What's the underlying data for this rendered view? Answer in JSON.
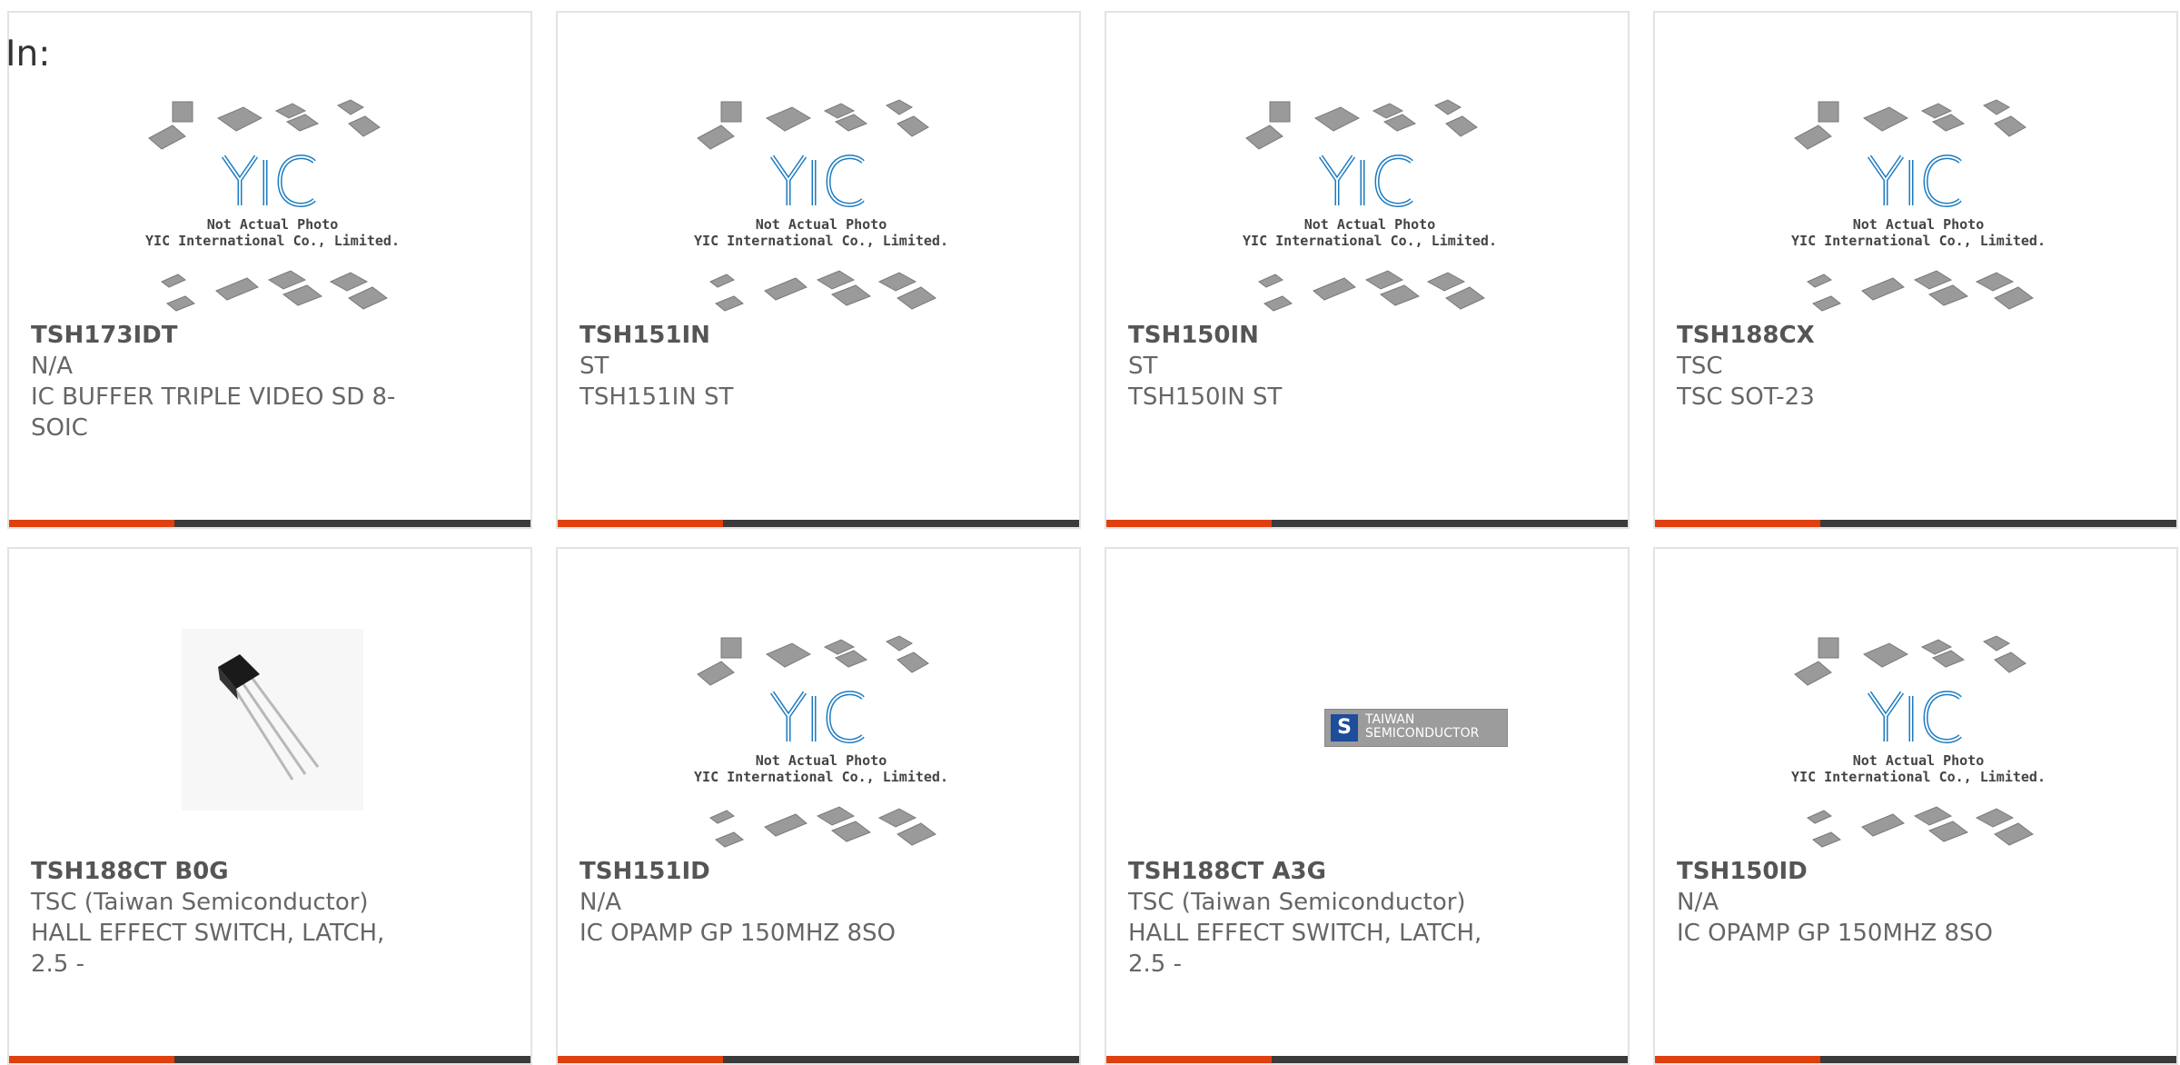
{
  "header": {
    "label": "In:"
  },
  "placeholder": {
    "line1": "Not Actual Photo",
    "line2": "YIC International Co., Limited.",
    "logo": "YIC"
  },
  "tsc_logo": {
    "line1": "TAIWAN",
    "line2": "SEMICONDUCTOR"
  },
  "colors": {
    "accent": "#e0400f",
    "bar": "#3b3b3b",
    "yic_blue": "#1b7bc0"
  },
  "products": [
    {
      "part": "TSH173IDT",
      "maker": "N/A",
      "desc": "IC BUFFER TRIPLE VIDEO SD 8-SOIC",
      "image": "placeholder"
    },
    {
      "part": "TSH151IN",
      "maker": "ST",
      "desc": "TSH151IN ST",
      "image": "placeholder"
    },
    {
      "part": "TSH150IN",
      "maker": "ST",
      "desc": "TSH150IN ST",
      "image": "placeholder"
    },
    {
      "part": "TSH188CX",
      "maker": "TSC",
      "desc": "TSC SOT-23",
      "image": "placeholder"
    },
    {
      "part": "TSH188CT B0G",
      "maker": "TSC (Taiwan Semiconductor)",
      "desc": "HALL EFFECT SWITCH, LATCH, 2.5 -",
      "image": "transistor"
    },
    {
      "part": "TSH151ID",
      "maker": "N/A",
      "desc": "IC OPAMP GP 150MHZ 8SO",
      "image": "placeholder"
    },
    {
      "part": "TSH188CT A3G",
      "maker": "TSC (Taiwan Semiconductor)",
      "desc": "HALL EFFECT SWITCH, LATCH, 2.5 -",
      "image": "tsc-logo"
    },
    {
      "part": "TSH150ID",
      "maker": "N/A",
      "desc": "IC OPAMP GP 150MHZ 8SO",
      "image": "placeholder"
    }
  ]
}
